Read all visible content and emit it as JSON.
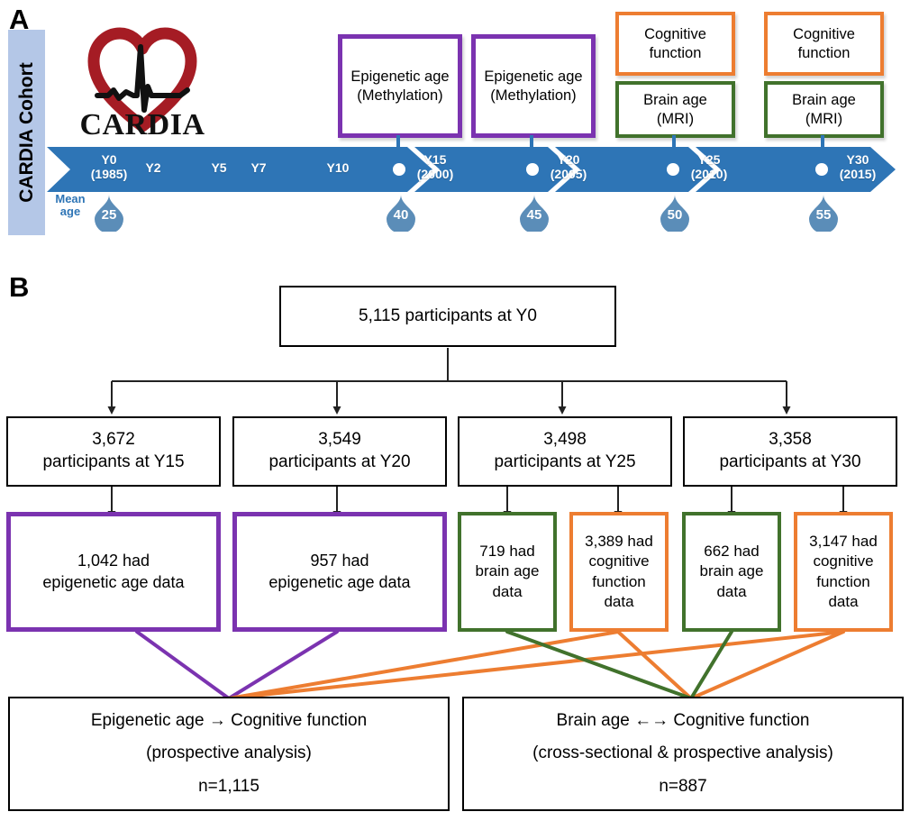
{
  "panels": {
    "a_letter": "A",
    "b_letter": "B"
  },
  "panel_a": {
    "cohort_label": "CARDIA Cohort",
    "logo_text": "CARDIA",
    "logo_name": "cardia-heart-ecg-logo",
    "mean_age_label": "Mean\nage",
    "mean_age_label_line1": "Mean",
    "mean_age_label_line2": "age",
    "colors": {
      "sidebar": "#b4c7e7",
      "timeline": "#2E75B6",
      "purple": "#7B33B0",
      "orange": "#ED7D31",
      "green": "#41722C",
      "droplet": "#5B8DB8",
      "logo_red": "#A51C24"
    },
    "measurement_boxes": [
      {
        "id": "epigenetic-y15",
        "color": "purple",
        "line1": "Epigenetic age",
        "line2": "(Methylation)"
      },
      {
        "id": "epigenetic-y20",
        "color": "purple",
        "line1": "Epigenetic age",
        "line2": "(Methylation)"
      },
      {
        "id": "cognitive-y25",
        "color": "orange",
        "line1": "Cognitive",
        "line2": "function"
      },
      {
        "id": "brainage-y25",
        "color": "green",
        "line1": "Brain age",
        "line2": "(MRI)"
      },
      {
        "id": "cognitive-y30",
        "color": "orange",
        "line1": "Cognitive",
        "line2": "function"
      },
      {
        "id": "brainage-y30",
        "color": "green",
        "line1": "Brain age",
        "line2": "(MRI)"
      }
    ],
    "timeline_points": [
      {
        "id": "y0",
        "label": "Y0",
        "year": "(1985)",
        "mean_age": "25",
        "has_dot": false
      },
      {
        "id": "y2",
        "label": "Y2",
        "year": "",
        "mean_age": "",
        "has_dot": false
      },
      {
        "id": "y5",
        "label": "Y5",
        "year": "",
        "mean_age": "",
        "has_dot": false
      },
      {
        "id": "y7",
        "label": "Y7",
        "year": "",
        "mean_age": "",
        "has_dot": false
      },
      {
        "id": "y10",
        "label": "Y10",
        "year": "",
        "mean_age": "",
        "has_dot": false
      },
      {
        "id": "y15",
        "label": "Y15",
        "year": "(2000)",
        "mean_age": "40",
        "has_dot": true
      },
      {
        "id": "y20",
        "label": "Y20",
        "year": "(2005)",
        "mean_age": "45",
        "has_dot": true
      },
      {
        "id": "y25",
        "label": "Y25",
        "year": "(2010)",
        "mean_age": "50",
        "has_dot": true
      },
      {
        "id": "y30",
        "label": "Y30",
        "year": "(2015)",
        "mean_age": "55",
        "has_dot": true
      }
    ]
  },
  "panel_b": {
    "root": {
      "text": "5,115 participants at Y0"
    },
    "level1": [
      {
        "id": "y15",
        "line1": "3,672",
        "line2": "participants at Y15"
      },
      {
        "id": "y20",
        "line1": "3,549",
        "line2": "participants at Y20"
      },
      {
        "id": "y25",
        "line1": "3,498",
        "line2": "participants at Y25"
      },
      {
        "id": "y30",
        "line1": "3,358",
        "line2": "participants at Y30"
      }
    ],
    "level2": [
      {
        "id": "epi-y15",
        "color": "purple",
        "line1": "1,042 had",
        "line2": "epigenetic age data",
        "line3": "",
        "line4": ""
      },
      {
        "id": "epi-y20",
        "color": "purple",
        "line1": "957 had",
        "line2": "epigenetic age data",
        "line3": "",
        "line4": ""
      },
      {
        "id": "brain-y25",
        "color": "green",
        "line1": "719 had",
        "line2": "brain age",
        "line3": "data",
        "line4": ""
      },
      {
        "id": "cog-y25",
        "color": "orange",
        "line1": "3,389 had",
        "line2": "cognitive",
        "line3": "function",
        "line4": "data"
      },
      {
        "id": "brain-y30",
        "color": "green",
        "line1": "662 had",
        "line2": "brain age",
        "line3": "data",
        "line4": ""
      },
      {
        "id": "cog-y30",
        "color": "orange",
        "line1": "3,147 had",
        "line2": "cognitive",
        "line3": "function",
        "line4": "data"
      }
    ],
    "results": [
      {
        "id": "epigenetic-result",
        "line1": "Epigenetic age → Cognitive function",
        "line2": "(prospective analysis)",
        "line3": "n=1,115"
      },
      {
        "id": "brainage-result",
        "line1": "Brain age ←→ Cognitive function",
        "line2": "(cross-sectional & prospective analysis)",
        "line3": "n=887"
      }
    ]
  }
}
